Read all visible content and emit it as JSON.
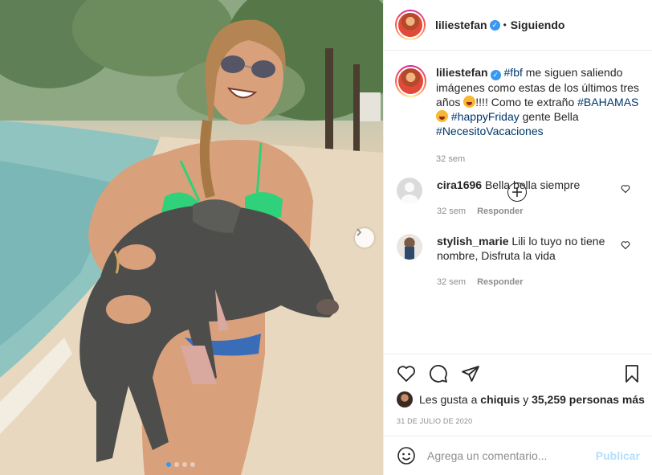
{
  "post": {
    "username": "liliestefan",
    "follow_status": "Siguiendo",
    "separator": "•",
    "caption": {
      "username": "liliestefan",
      "tag_fbf": "#fbf",
      "text1": " me siguen saliendo imágenes como estas de los últimos tres años ",
      "text2": "!!!! Como te extraño ",
      "tag_bahamas": "#BAHAMAS",
      "text3": " ",
      "tag_happyfriday": "#happyFriday",
      "text4": " gente Bella ",
      "tag_vacaciones": "#NecesitoVacaciones",
      "time": "32 sem"
    },
    "comments": [
      {
        "username": "cira1696",
        "text": "Bella bella siempre",
        "time": "32 sem",
        "reply": "Responder"
      },
      {
        "username": "stylish_marie",
        "text": "Lili lo tuyo no tiene nombre, Disfruta la vida",
        "time": "32 sem",
        "reply": "Responder"
      }
    ],
    "likes": {
      "prefix": "Les gusta a ",
      "user": "chiquis",
      "middle": " y ",
      "count": "35,259 personas más"
    },
    "date": "31 DE JULIO DE 2020",
    "add_comment_placeholder": "Agrega un comentario...",
    "post_label": "Publicar"
  },
  "carousel": {
    "total": 4,
    "active": 1
  },
  "colors": {
    "verified": "#3897f0",
    "tag": "#00376b",
    "muted": "#8e8e8e",
    "post_disabled": "#b2dffc"
  }
}
